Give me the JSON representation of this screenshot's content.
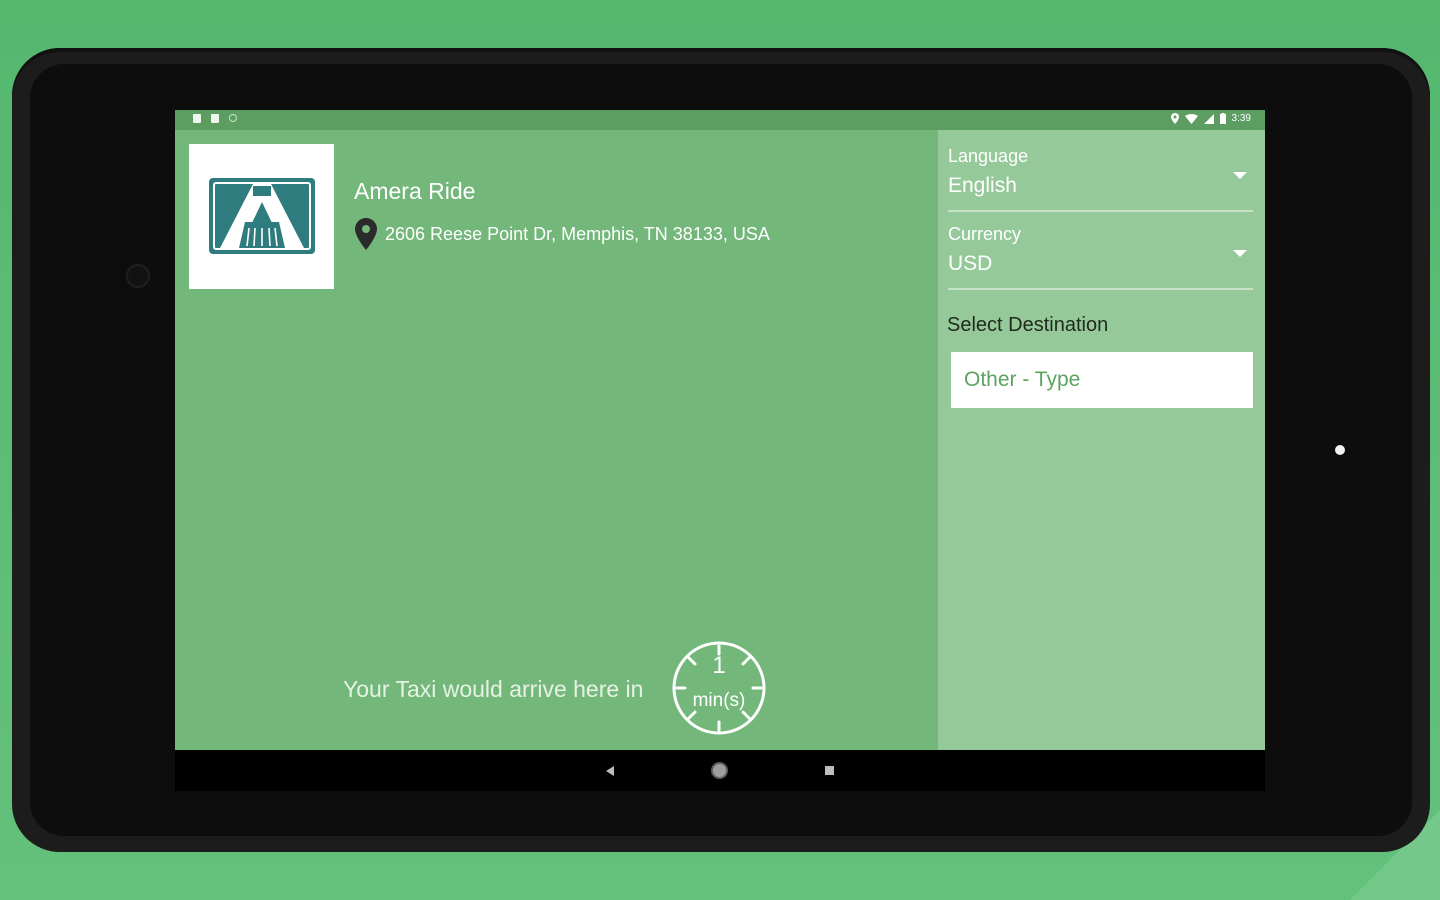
{
  "status_bar": {
    "time": "3:39"
  },
  "header": {
    "company_name": "Amera Ride",
    "address": "2606 Reese Point Dr, Memphis, TN 38133, USA"
  },
  "eta": {
    "message": "Your Taxi would arrive here in",
    "value": "1",
    "unit": "min(s)"
  },
  "settings": {
    "language_label": "Language",
    "language_value": "English",
    "currency_label": "Currency",
    "currency_value": "USD",
    "destination_label": "Select Destination",
    "destination_placeholder": "Other - Type"
  },
  "colors": {
    "main_panel": "#73b87a",
    "side_panel": "#96c99a",
    "logo_teal": "#2f7c7f",
    "background": "#55b86f"
  },
  "icons": [
    "location-pin-icon",
    "timer-icon",
    "dropdown-arrow-icon",
    "nav-back-icon",
    "nav-home-icon",
    "nav-recent-icon"
  ]
}
